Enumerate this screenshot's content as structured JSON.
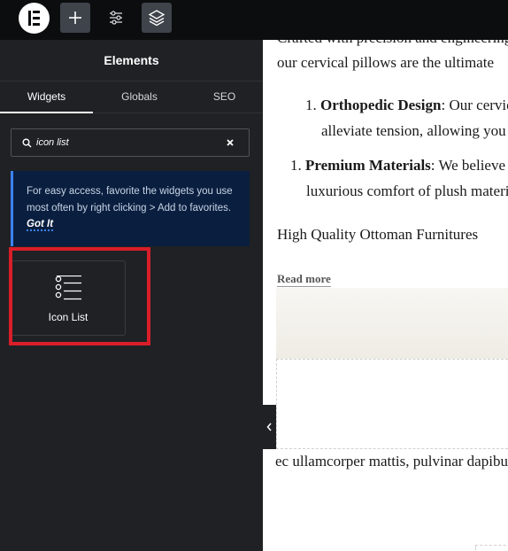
{
  "app": {
    "logo_icon": "elementor-logo-icon",
    "toolbar": [
      {
        "icon": "plus-icon"
      },
      {
        "icon": "sliders-icon"
      },
      {
        "icon": "layers-icon"
      }
    ]
  },
  "panel": {
    "title": "Elements",
    "tabs": [
      {
        "label": "Widgets",
        "active": true
      },
      {
        "label": "Globals",
        "active": false
      },
      {
        "label": "SEO",
        "active": false
      }
    ],
    "search": {
      "value": "icon list",
      "placeholder": ""
    },
    "tip": {
      "text": "For easy access, favorite the widgets you use most often by right clicking > Add to favorites.",
      "link": "Got It"
    },
    "widgets": [
      {
        "label": "Icon List",
        "icon": "icon-list-icon"
      }
    ],
    "highlight_color": "#d91e2a"
  },
  "canvas": {
    "intro": "Crafted with precision and engineering,",
    "intro2": "our cervical pillows are the ultimate",
    "list_item_1_num": "1.",
    "list_item_1_title": "Orthopedic Design",
    "list_item_1_text": ": Our cervical",
    "list_item_1_line2": "alleviate tension, allowing you",
    "list_item_2_num": "1.",
    "list_item_2_title": "Premium Materials",
    "list_item_2_text": ": We believe",
    "list_item_2_line2": "luxurious comfort of plush materials",
    "heading": "High Quality Ottoman Furnitures",
    "read_more": "Read more",
    "footer_text": "ec ullamcorper mattis, pulvinar dapibus"
  }
}
